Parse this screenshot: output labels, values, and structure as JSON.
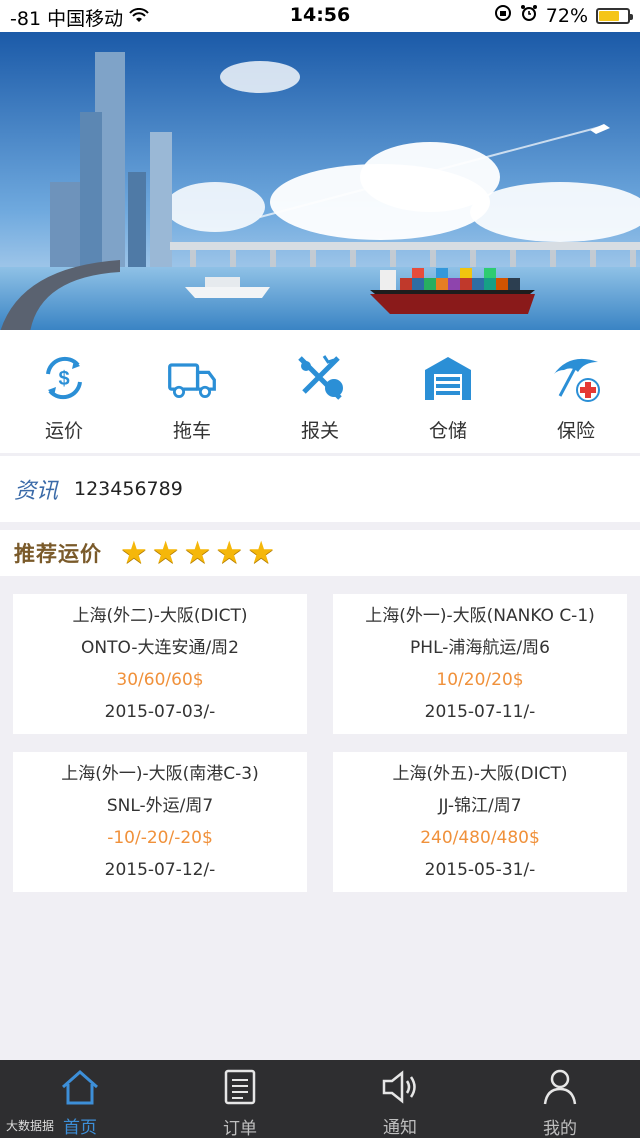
{
  "status_bar": {
    "carrier": "-81 中国移动",
    "time": "14:56",
    "battery": "72%",
    "battery_level": 0.72
  },
  "banner": {
    "icon": "city-harbor-banner-image"
  },
  "categories": [
    {
      "label": "运价",
      "icon": "freight-rate-icon"
    },
    {
      "label": "拖车",
      "icon": "truck-icon"
    },
    {
      "label": "报关",
      "icon": "customs-icon"
    },
    {
      "label": "仓储",
      "icon": "warehouse-icon"
    },
    {
      "label": "保险",
      "icon": "insurance-icon"
    }
  ],
  "news": {
    "tag": "资讯",
    "text": "123456789"
  },
  "recommend": {
    "title": "推荐运价",
    "rating": 5
  },
  "cards": [
    {
      "route": "上海(外二)-大阪(DICT)",
      "carrier": "ONTO-大连安通/周2",
      "price": "30/60/60$",
      "date": "2015-07-03/-"
    },
    {
      "route": "上海(外一)-大阪(NANKO C-1)",
      "carrier": "PHL-浦海航运/周6",
      "price": "10/20/20$",
      "date": "2015-07-11/-"
    },
    {
      "route": "上海(外一)-大阪(南港C-3)",
      "carrier": "SNL-外运/周7",
      "price": "-10/-20/-20$",
      "date": "2015-07-12/-"
    },
    {
      "route": "上海(外五)-大阪(DICT)",
      "carrier": "JJ-锦江/周7",
      "price": "240/480/480$",
      "date": "2015-05-31/-"
    }
  ],
  "tabbar": {
    "items": [
      {
        "label": "首页",
        "icon": "home-icon",
        "active": true
      },
      {
        "label": "订单",
        "icon": "order-icon",
        "active": false
      },
      {
        "label": "通知",
        "icon": "speaker-icon",
        "active": false
      },
      {
        "label": "我的",
        "icon": "person-icon",
        "active": false
      }
    ],
    "watermark": "大数据据"
  },
  "colors": {
    "accent": "#3d8fd8",
    "price": "#f0913b",
    "tabbar_bg": "#2e2e30",
    "star": "#f5b70a"
  }
}
